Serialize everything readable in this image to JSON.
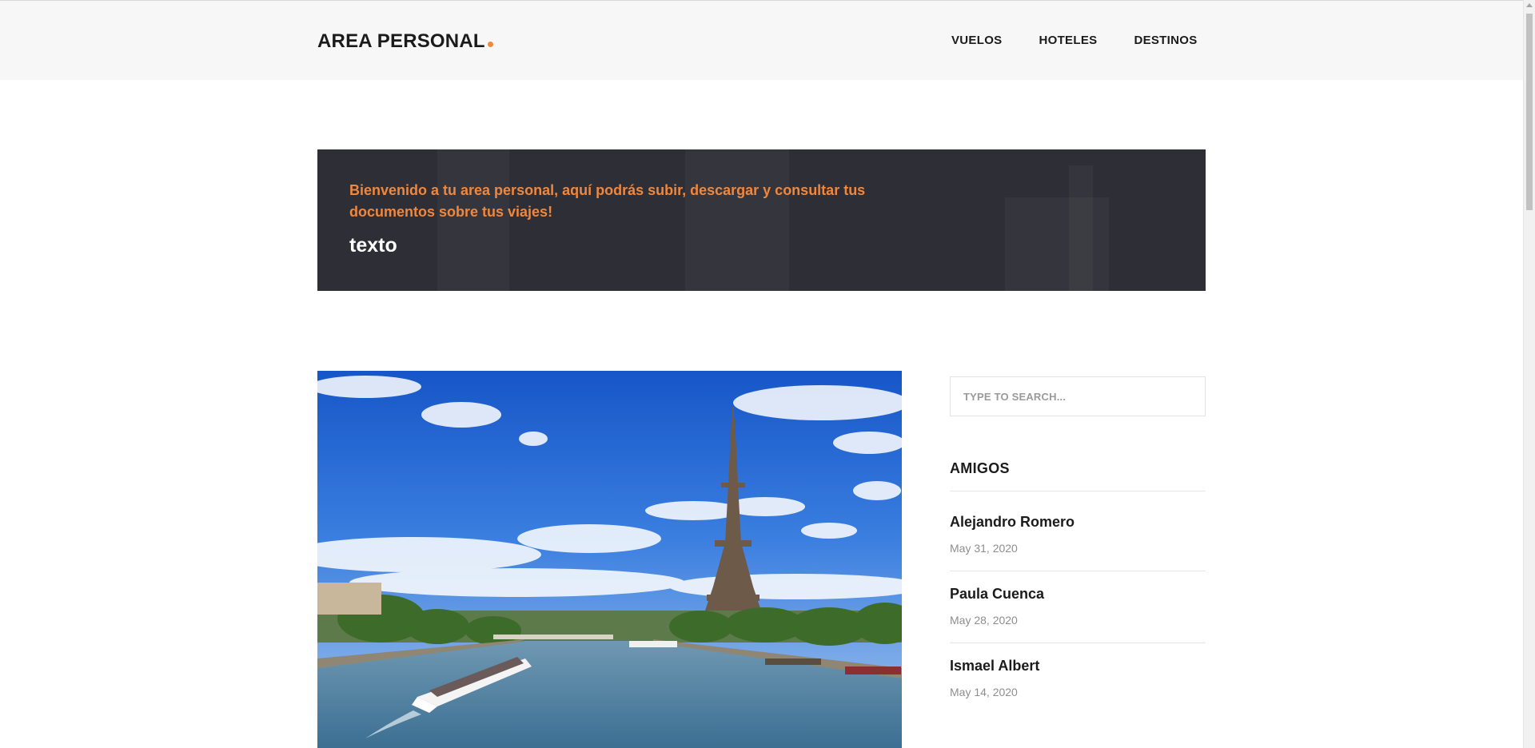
{
  "header": {
    "logo_text": "AREA PERSONAL",
    "accent_color": "#f08a3e",
    "nav": [
      {
        "label": "VUELOS"
      },
      {
        "label": "HOTELES"
      },
      {
        "label": "DESTINOS"
      }
    ]
  },
  "banner": {
    "message": "Bienvenido a tu area personal, aquí podrás subir, descargar y consultar tus documentos sobre tus viajes!",
    "title": "texto"
  },
  "main": {
    "photo_icon": "eiffel-tower-photo"
  },
  "sidebar": {
    "search_placeholder": "TYPE TO SEARCH...",
    "heading": "AMIGOS",
    "friends": [
      {
        "name": "Alejandro Romero",
        "date": "May 31, 2020"
      },
      {
        "name": "Paula Cuenca",
        "date": "May 28, 2020"
      },
      {
        "name": "Ismael Albert",
        "date": "May 14, 2020"
      }
    ]
  }
}
